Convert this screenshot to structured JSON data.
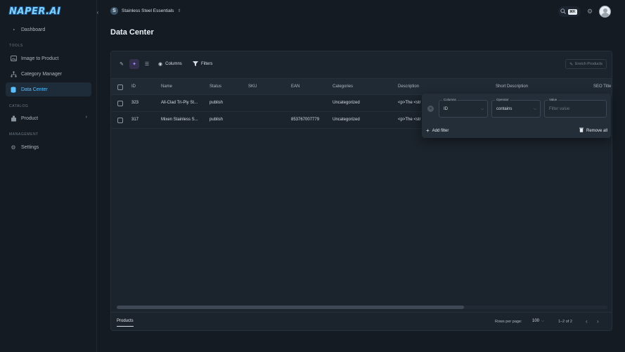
{
  "brand": {
    "logo_text": "NAPER.AI",
    "accent": "#5cc0ff"
  },
  "sidebar": {
    "top_items": [
      {
        "label": "Dashboard",
        "icon": "gauge-icon"
      }
    ],
    "sections": {
      "tools": "TOOLS",
      "catalog": "CATALOG",
      "management": "MANAGEMENT"
    },
    "tools_items": [
      {
        "label": "Image to Product",
        "icon": "image-icon"
      },
      {
        "label": "Category Manager",
        "icon": "hierarchy-icon"
      },
      {
        "label": "Data Center",
        "icon": "database-icon",
        "active": true
      }
    ],
    "catalog_items": [
      {
        "label": "Product",
        "icon": "box-icon"
      }
    ],
    "management_items": [
      {
        "label": "Settings",
        "icon": "gear-icon"
      }
    ]
  },
  "topbar": {
    "store_initial": "S",
    "store_name": "Stainless Steel Essentials",
    "shortcut": "⌘K"
  },
  "page": {
    "title": "Data Center"
  },
  "toolbar": {
    "columns_label": "Columns",
    "filters_label": "Filters",
    "enrich_label": "Enrich Products"
  },
  "table": {
    "columns": [
      "ID",
      "Name",
      "Status",
      "SKU",
      "EAN",
      "Categories",
      "Description",
      "Short Description",
      "SEO Title"
    ],
    "rows": [
      {
        "id": "323",
        "name": "All-Clad Tri-Ply St...",
        "status": "publish",
        "sku": "",
        "ean": "",
        "categories": "Uncategorized",
        "description": "<p>The <str"
      },
      {
        "id": "317",
        "name": "Mixen Stainless S...",
        "status": "publish",
        "sku": "",
        "ean": "853767007779",
        "categories": "Uncategorized",
        "description": "<p>The <str"
      }
    ]
  },
  "filter": {
    "columns_label": "Columns",
    "columns_value": "ID",
    "operator_label": "Operator",
    "operator_value": "contains",
    "value_label": "Value",
    "value_placeholder": "Filter value",
    "add_label": "Add filter",
    "remove_label": "Remove all"
  },
  "footer": {
    "tab_label": "Products",
    "rows_per_page_label": "Rows per page:",
    "rows_per_page_value": "100",
    "range": "1–2 of 2"
  }
}
